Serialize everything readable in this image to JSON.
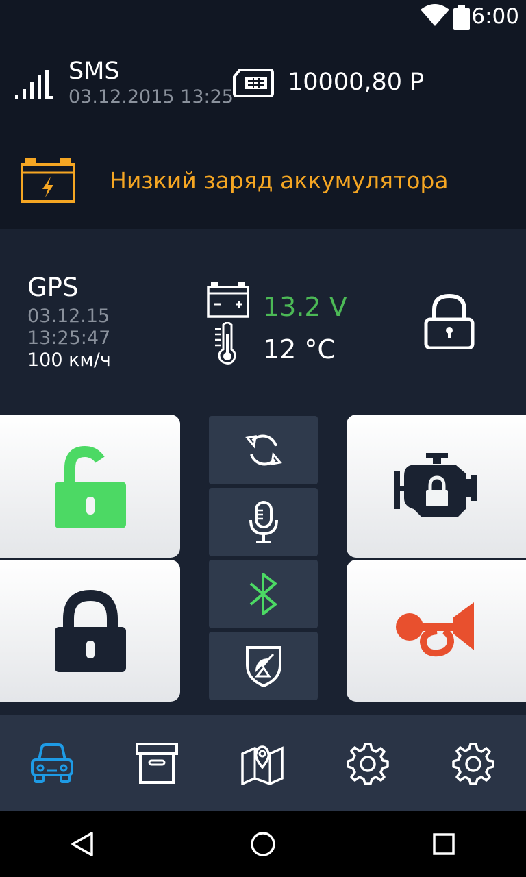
{
  "status_bar": {
    "time": "6:00",
    "icons": [
      "wifi-icon",
      "battery-icon"
    ]
  },
  "header": {
    "sms_title": "SMS",
    "sms_date": "03.12.2015 13:25",
    "balance": "10000,80 Р",
    "alert_text": "Низкий заряд аккумулятора",
    "icons": [
      "signal-icon",
      "sim-card-icon",
      "low-battery-alert-icon"
    ]
  },
  "info": {
    "gps_title": "GPS",
    "gps_date": "03.12.15",
    "gps_time": "13:25:47",
    "speed": "100 км/ч",
    "voltage": "13.2 V",
    "temperature": "12 °C",
    "icons": [
      "car-battery-icon",
      "thermometer-icon",
      "padlock-closed-icon"
    ]
  },
  "controls": {
    "big_buttons": [
      "unlock-icon",
      "lock-icon",
      "engine-lock-icon",
      "horn-icon"
    ],
    "small_buttons": [
      "sync-icon",
      "microphone-icon",
      "bluetooth-icon",
      "satellite-shield-icon"
    ]
  },
  "tabs": [
    "car-icon",
    "archive-icon",
    "map-icon",
    "gear-icon",
    "gear-icon"
  ],
  "colors": {
    "accent_blue": "#1e9be6",
    "voltage_green": "#4cb956",
    "alert_orange": "#f5a623",
    "unlock_green": "#4cd964",
    "horn_red": "#e8502e",
    "dark_navy": "#1a2231"
  }
}
